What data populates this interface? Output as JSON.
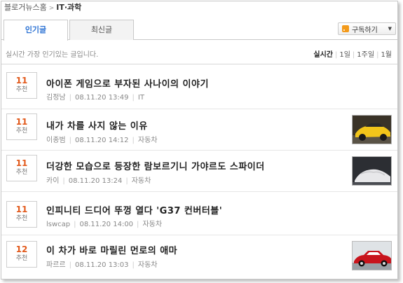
{
  "breadcrumb": {
    "root": "블로거뉴스홈",
    "current": "IT·과학"
  },
  "tabs": [
    {
      "label": "인기글"
    },
    {
      "label": "최신글"
    }
  ],
  "subscribe": {
    "label": "구독하기"
  },
  "description": "실시간 가장 인기있는 글입니다.",
  "periods": [
    "실시간",
    "1일",
    "1주일",
    "1월"
  ],
  "items": [
    {
      "count": "11",
      "rec_label": "추천",
      "title": "아이폰 게임으로 부자된 사나이의 이야기",
      "author": "김정남",
      "date": "08.11.20 13:49",
      "category": "IT",
      "thumb": ""
    },
    {
      "count": "11",
      "rec_label": "추천",
      "title": "내가 차를 사지 않는 이유",
      "author": "이종범",
      "date": "08.11.20 14:12",
      "category": "자동차",
      "thumb": "yellow-sports-car"
    },
    {
      "count": "11",
      "rec_label": "추천",
      "title": "더강한 모습으로 등장한 람보르기니 가야르도 스파이더",
      "author": "카이",
      "date": "08.11.20 13:24",
      "category": "자동차",
      "thumb": "white-covered-car"
    },
    {
      "count": "11",
      "rec_label": "추천",
      "title": "인피니티 드디어 뚜껑 열다 'G37 컨버터블'",
      "author": "lswcap",
      "date": "08.11.20 14:00",
      "category": "자동차",
      "thumb": ""
    },
    {
      "count": "12",
      "rec_label": "추천",
      "title": "이 차가 바로 마릴린 먼로의 애마",
      "author": "파르르",
      "date": "08.11.20 13:03",
      "category": "자동차",
      "thumb": "red-classic-car"
    }
  ],
  "colors": {
    "accent": "#2b72d4",
    "count": "#e25a1c",
    "rss": "#f39a1a"
  }
}
